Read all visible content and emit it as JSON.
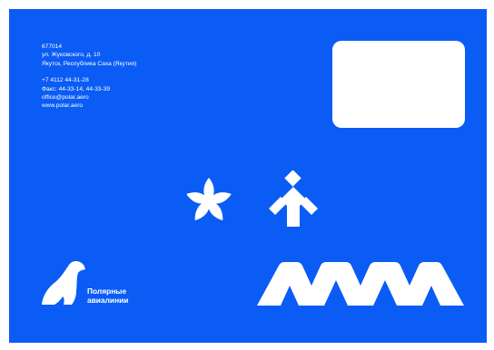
{
  "address": {
    "postal_code": "677014",
    "street": "ул. Жуковского, д. 10",
    "city": "Якутск, Республика Саха (Якутия)",
    "phone": "+7 4112 44-31-28",
    "fax": "Факс: 44-33-14, 44-33-39",
    "email": "office@polar.aero",
    "website": "www.polar.aero"
  },
  "brand": {
    "name_line1": "Полярные",
    "name_line2": "авиалинии"
  },
  "colors": {
    "background": "#0a5cf5",
    "foreground": "#ffffff"
  },
  "icons": [
    "flower-icon",
    "person-icon",
    "polar-bear-logo",
    "zigzag-ornament"
  ]
}
